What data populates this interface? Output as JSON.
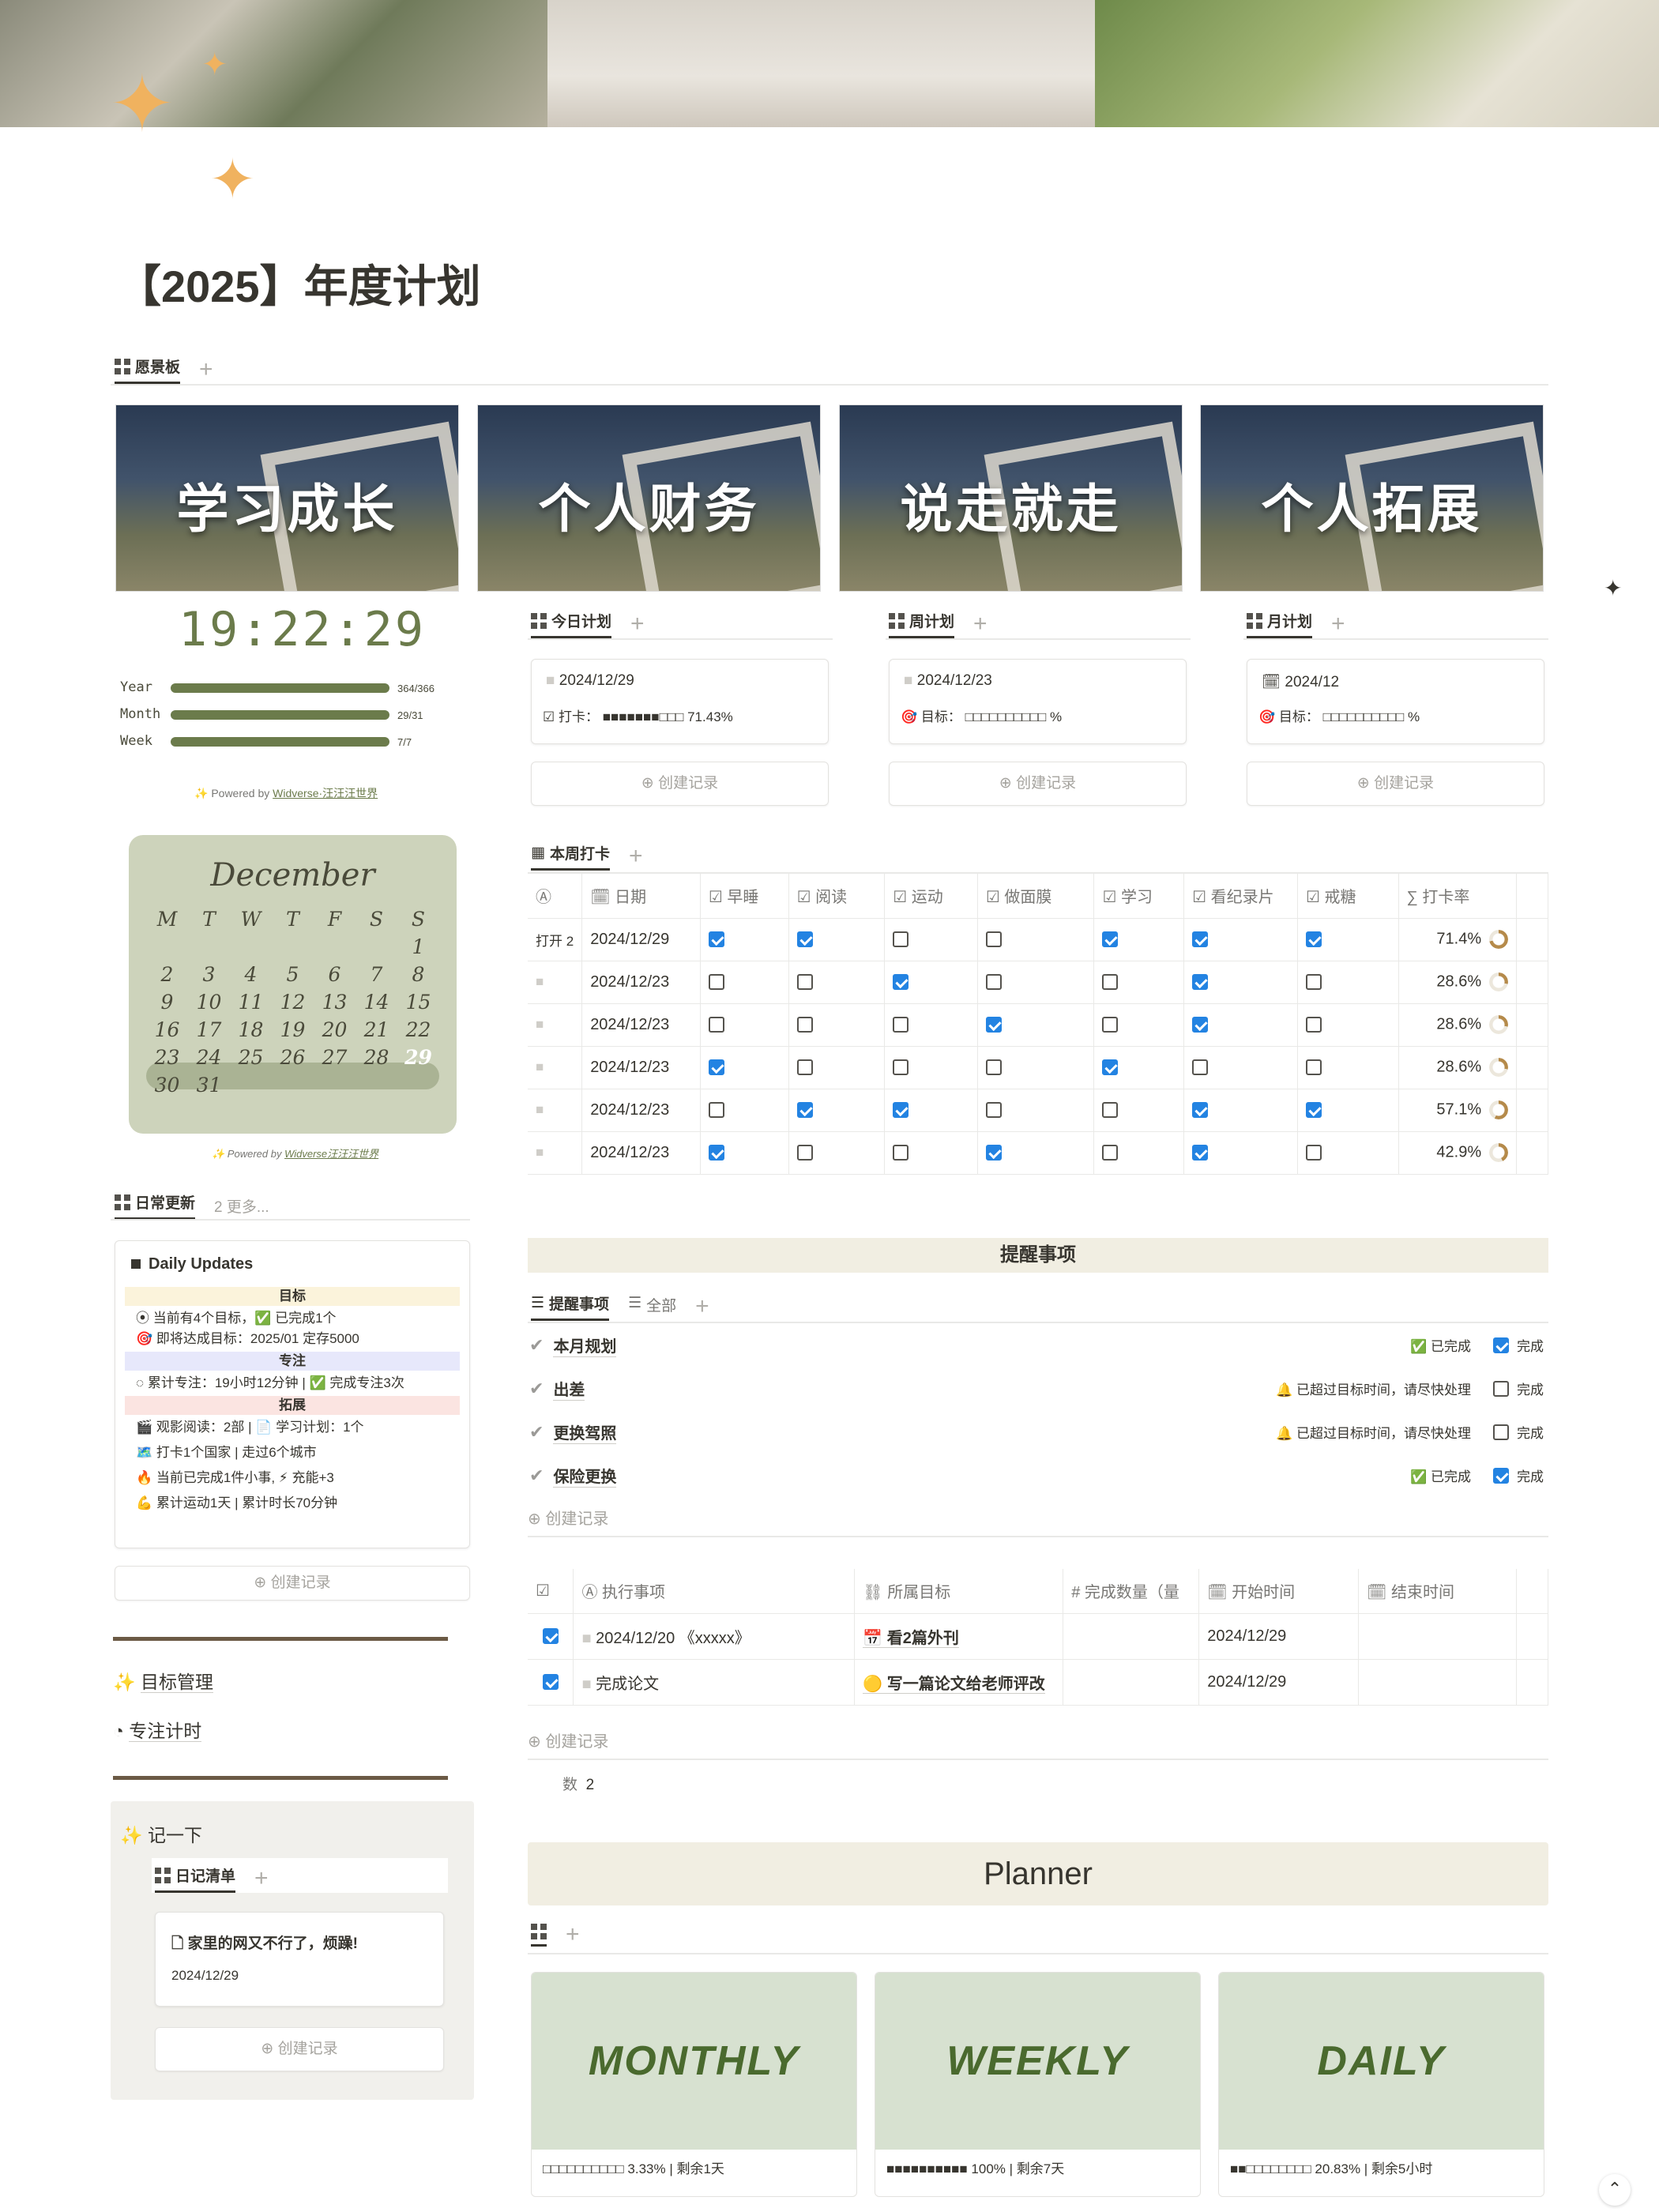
{
  "page": {
    "title": "【2025】年度计划",
    "star_icons": [
      "sparkle-icon",
      "sparkle-icon",
      "sparkle-icon"
    ]
  },
  "vision_tab": {
    "label": "愿景板"
  },
  "vision_cards": [
    "学习成长",
    "个人财务",
    "说走就走",
    "个人拓展"
  ],
  "clock": {
    "time": "19:22:29",
    "year_label": "Year",
    "year_value": "364/366",
    "year_progress": 0.995,
    "month_label": "Month",
    "month_value": "29/31",
    "month_progress": 0.935,
    "week_label": "Week",
    "week_value": "7/7",
    "week_progress": 1.0,
    "powered": "✨ Powered by ",
    "powered_link": "Widverse·汪汪汪世界"
  },
  "calendar": {
    "month": "December",
    "weekdays": [
      "M",
      "T",
      "W",
      "T",
      "F",
      "S",
      "S"
    ],
    "days": [
      "",
      "",
      "",
      "",
      "",
      "",
      "1",
      "2",
      "3",
      "4",
      "5",
      "6",
      "7",
      "8",
      "9",
      "10",
      "11",
      "12",
      "13",
      "14",
      "15",
      "16",
      "17",
      "18",
      "19",
      "20",
      "21",
      "22",
      "23",
      "24",
      "25",
      "26",
      "27",
      "28",
      "29",
      "30",
      "31"
    ],
    "today": "29",
    "powered": "✨ Powered by ",
    "powered_link": "Widverse汪汪汪世界"
  },
  "plans": {
    "today": {
      "tab": "今日计划",
      "date": "2024/12/29",
      "line_label": "打卡：",
      "line_value": "■■■■■■■□□□ 71.43%",
      "create": "创建记录"
    },
    "week": {
      "tab": "周计划",
      "date": "2024/12/23",
      "line_label": "目标：",
      "line_value": "□□□□□□□□□□ %",
      "create": "创建记录"
    },
    "month": {
      "tab": "月计划",
      "date": "2024/12",
      "line_label": "目标：",
      "line_value": "□□□□□□□□□□ %",
      "create": "创建记录"
    }
  },
  "checkin": {
    "tab": "本周打卡",
    "headers": [
      "日期",
      "早睡",
      "阅读",
      "运动",
      "做面膜",
      "学习",
      "看纪录片",
      "戒糖",
      "打卡率"
    ],
    "rows": [
      {
        "prefix": "打开 2",
        "date": "2024/12/29",
        "checks": [
          1,
          1,
          0,
          0,
          1,
          1,
          1
        ],
        "rate": "71.4%"
      },
      {
        "prefix": "",
        "date": "2024/12/23",
        "checks": [
          0,
          0,
          1,
          0,
          0,
          1,
          0
        ],
        "rate": "28.6%"
      },
      {
        "prefix": "",
        "date": "2024/12/23",
        "checks": [
          0,
          0,
          0,
          1,
          0,
          1,
          0
        ],
        "rate": "28.6%"
      },
      {
        "prefix": "",
        "date": "2024/12/23",
        "checks": [
          1,
          0,
          0,
          0,
          1,
          0,
          0
        ],
        "rate": "28.6%"
      },
      {
        "prefix": "",
        "date": "2024/12/23",
        "checks": [
          0,
          1,
          1,
          0,
          0,
          1,
          1
        ],
        "rate": "57.1%"
      },
      {
        "prefix": "",
        "date": "2024/12/23",
        "checks": [
          1,
          0,
          0,
          1,
          0,
          1,
          0
        ],
        "rate": "42.9%"
      }
    ]
  },
  "daily": {
    "tab": "日常更新",
    "more": "2 更多...",
    "title": "Daily Updates",
    "sec1": "目标",
    "l1": "当前有4个目标，✅ 已完成1个",
    "l2": "即将达成目标：2025/01 定存5000",
    "sec2": "专注",
    "l3": "累计专注：19小时12分钟 | ✅ 完成专注3次",
    "sec3": "拓展",
    "l4": "🎬 观影阅读：2部 | 📄 学习计划：1个",
    "l5": "🗺️ 打卡1个国家 | 走过6个城市",
    "l6": "🔥 当前已完成1件小事, ⚡ 充能+3",
    "l7": "💪 累计运动1天 | 累计时长70分钟",
    "create": "创建记录"
  },
  "side_links": {
    "goal": "目标管理",
    "focus": "专注计时"
  },
  "notes": {
    "title": "记一下",
    "tab": "日记清单",
    "item": "家里的网又不行了，烦躁!",
    "date": "2024/12/29",
    "create": "创建记录"
  },
  "reminders": {
    "header": "提醒事项",
    "tab1": "提醒事项",
    "tab2": "全部",
    "items": [
      {
        "name": "本月规划",
        "status": "✅ 已完成",
        "done_label": "完成",
        "done": true
      },
      {
        "name": "出差",
        "status": "🔔 已超过目标时间，请尽快处理",
        "done_label": "完成",
        "done": false
      },
      {
        "name": "更换驾照",
        "status": "🔔 已超过目标时间，请尽快处理",
        "done_label": "完成",
        "done": false
      },
      {
        "name": "保险更换",
        "status": "✅ 已完成",
        "done_label": "完成",
        "done": true
      }
    ],
    "create": "创建记录"
  },
  "tasks": {
    "headers": [
      "执行事项",
      "所属目标",
      "完成数量（量",
      "开始时间",
      "结束时间"
    ],
    "rows": [
      {
        "done": true,
        "item": "2024/12/20 《xxxxx》",
        "goal": "📅 看2篇外刊",
        "start": "2024/12/29"
      },
      {
        "done": true,
        "item": "完成论文",
        "goal": "🟡 写一篇论文给老师评改",
        "start": "2024/12/29"
      }
    ],
    "create": "创建记录",
    "count_label": "数",
    "count_value": "2"
  },
  "planner": {
    "header": "Planner",
    "cards": [
      {
        "label": "MONTHLY",
        "progress": "□□□□□□□□□□ 3.33% | 剩余1天",
        "value": 0.0333
      },
      {
        "label": "WEEKLY",
        "progress": "■■■■■■■■■■ 100% | 剩余7天",
        "value": 1.0
      },
      {
        "label": "DAILY",
        "progress": "■■□□□□□□□□ 20.83% | 剩余5小时",
        "value": 0.2083
      }
    ]
  },
  "colors": {
    "accent": "#2383e2",
    "bar": "#6b7b4b",
    "calendar": "#cdd3bb",
    "planner_card": "#d7e1d0",
    "reminder_header": "#f1eee2"
  }
}
